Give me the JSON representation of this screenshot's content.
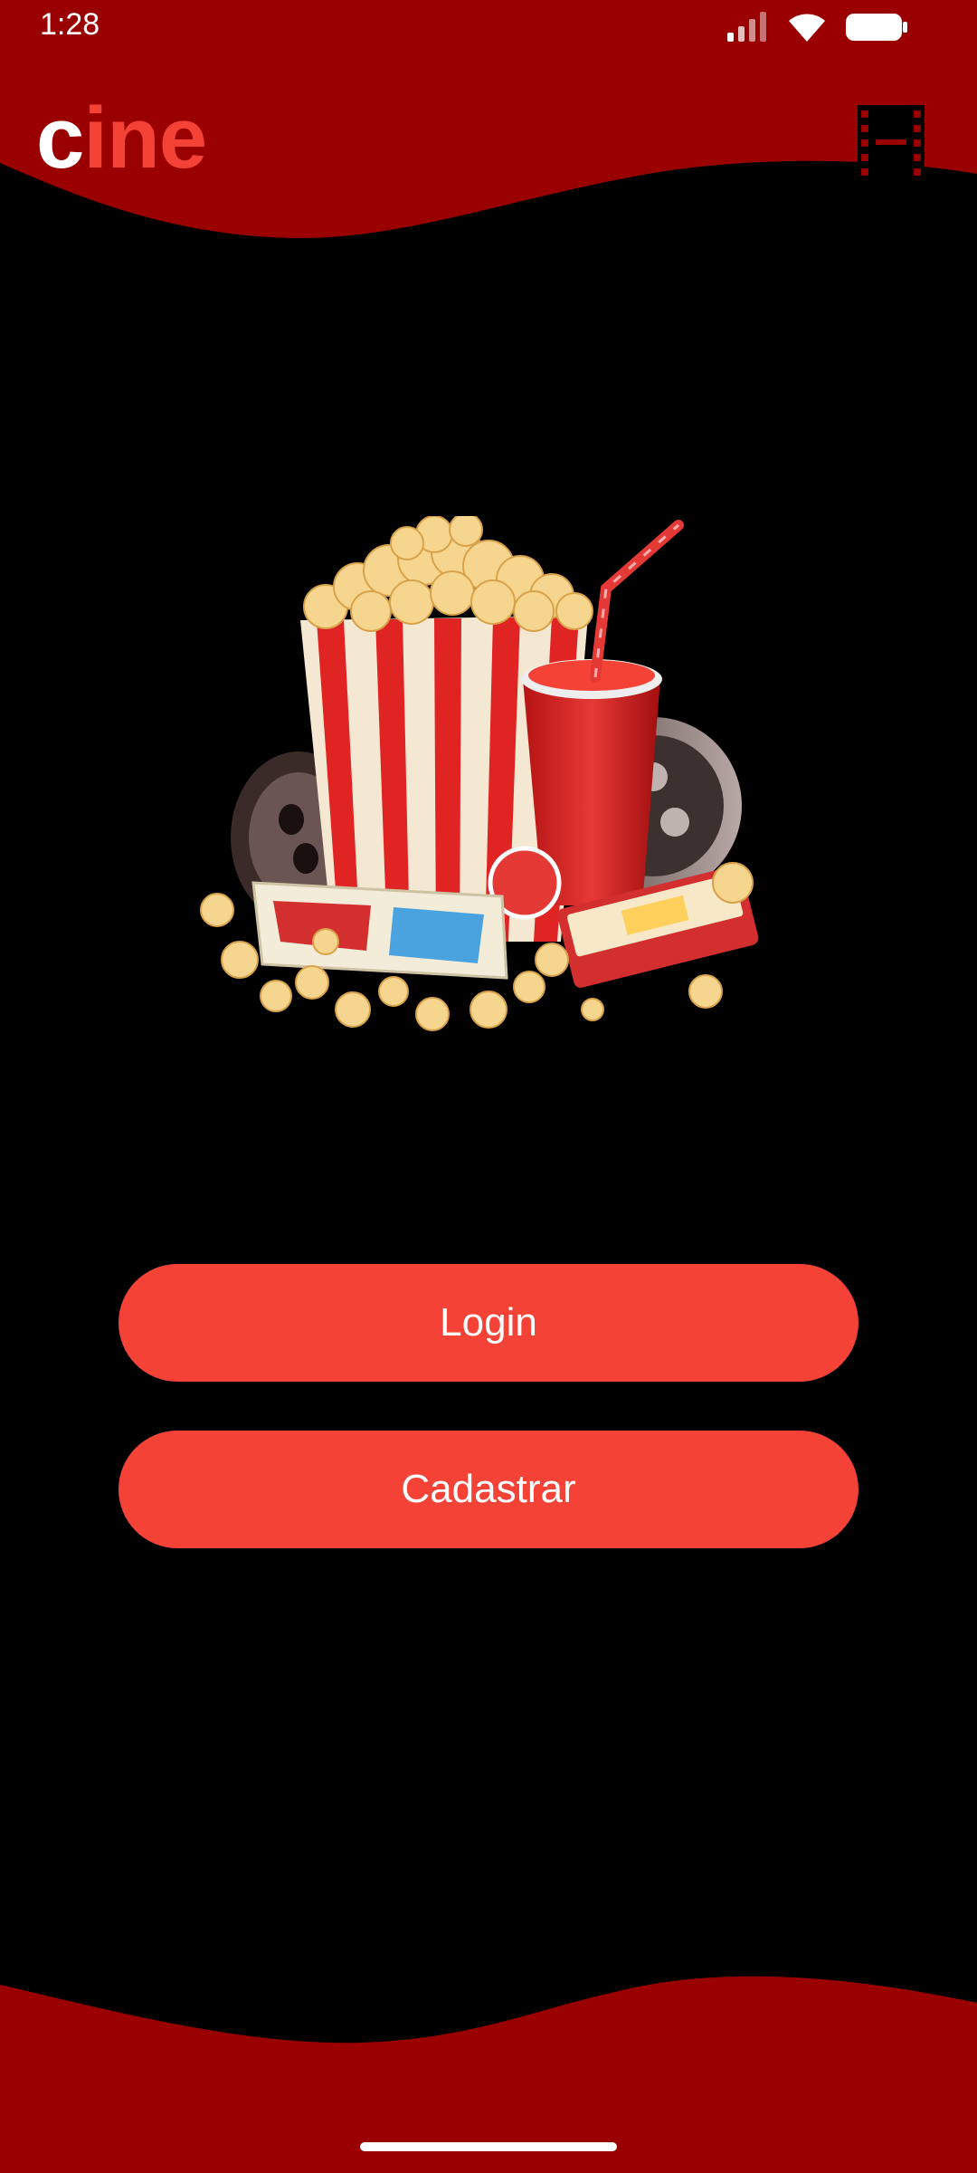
{
  "status_bar": {
    "time": "1:28"
  },
  "header": {
    "logo_first": "c",
    "logo_rest": "ine",
    "film_icon": "film-strip-icon"
  },
  "hero": {
    "image": "cinema-snacks-illustration"
  },
  "actions": {
    "login_label": "Login",
    "register_label": "Cadastrar"
  },
  "colors": {
    "brand_dark": "#9b0000",
    "accent": "#f44336",
    "background": "#000000",
    "text": "#ffffff"
  }
}
